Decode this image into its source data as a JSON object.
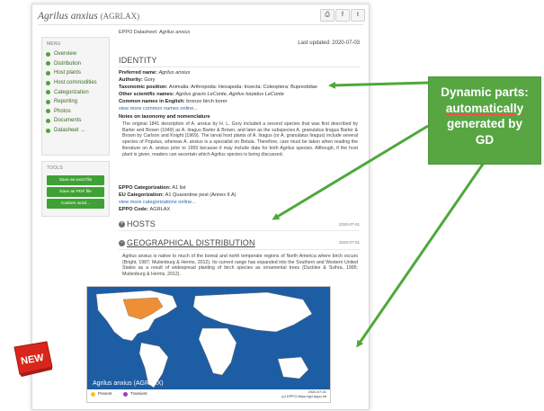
{
  "header": {
    "species": "Agrilus anxius",
    "code_tag": "(AGRLAX)",
    "share_icons": [
      "print-icon",
      "facebook-icon",
      "twitter-icon"
    ]
  },
  "sidebar": {
    "menu_title": "MENU",
    "items": [
      "Overview",
      "Distribution",
      "Host plants",
      "Host commodities",
      "Categorization",
      "Reporting",
      "Photos",
      "Documents",
      "Datasheet →"
    ],
    "tools_title": "TOOLS",
    "tools": [
      "Save as word file",
      "Save as PDF file",
      "Custom word..."
    ]
  },
  "main": {
    "datasheet_label": "EPPO Datasheet: ",
    "datasheet_species": "Agrilus anxius",
    "last_updated": "Last updated: 2020-07-03",
    "identity_heading": "IDENTITY",
    "identity": {
      "preferred_name_label": "Preferred name: ",
      "preferred_name": "Agrilus anxius",
      "authority_label": "Authority: ",
      "authority": "Gory",
      "taxonomic_label": "Taxonomic position: ",
      "taxonomic": "Animalia: Arthropoda: Hexapoda: Insecta: Coleoptera: Buprestidae",
      "other_names_label": "Other scientific names: ",
      "other_names": "Agrilus gravis LeConte, Agrilus torpidus LeConte",
      "common_names_label": "Common names in English: ",
      "common_names": "bronze birch borer",
      "more_common_names": "view more common names online...",
      "notes_label": "Notes on taxonomy and nomenclature",
      "notes_text": "The original 1841 description of A. anxius by H. L. Gory included a second species that was first described by Barter and Brown (1949) as A. liragus Barter & Brown, and later as the subspecies A. granulatus liragus Barter & Brown by Carlson and Knight (1969). The larval host plants of A. liragus (or A. granulatus liragus) include several species of Populus, whereas A. anxius is a specialist on Betula. Therefore, care must be taken when reading the literature on A. anxius prior to 1950 because it may include data for both Agrilus species. Although, if the host plant is given, readers can ascertain which Agrilus species is being discussed.",
      "categorization_label": "EPPO Categorization: ",
      "categorization": "A1 list",
      "eu_label": "EU Categorization: ",
      "eu": "A1 Quarantine pest (Annex II A)",
      "more_categorizations": "view more categorizations online...",
      "eppo_code_label": "EPPO Code: ",
      "eppo_code": "AGRLAX"
    },
    "hosts_heading": "HOSTS",
    "hosts_date": "2020-07-01",
    "geo_heading": "GEOGRAPHICAL DISTRIBUTION",
    "geo_date": "2020-07-01",
    "geo_text": "Agrilus anxius is native to much of the boreal and north temperate regions of North America where birch occurs (Bright, 1987; Muilenburg & Herms, 2012). Its current range has expanded into the Southern and Western United States as a result of widespread planting of birch species as ornamental trees (Duckles & Svihra, 1995; Muilenburg & Herms, 2012).",
    "map": {
      "title": "Agrilus anxius (AGRLAX)",
      "legend_present": "Present",
      "legend_transient": "Transient",
      "date": "2020-07-01",
      "credit": "(c) EPPO https://gd.eppo.int",
      "present_color": "#f2c418",
      "transient_color": "#9b3fbf",
      "ocean_color": "#1d5da4"
    }
  },
  "callout": {
    "line1": "Dynamic parts:",
    "line2": "automatically",
    "line3": "generated by",
    "line4": "GD",
    "color": "#57a642"
  },
  "badge": {
    "text": "NEW",
    "color": "#d9261c"
  }
}
